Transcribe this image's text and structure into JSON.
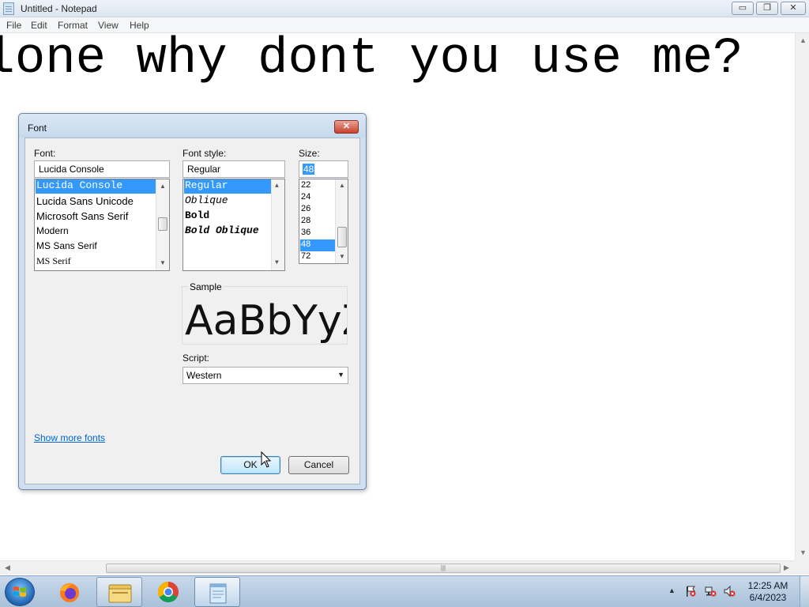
{
  "window": {
    "title": "Untitled - Notepad",
    "min_label": "▭",
    "max_label": "❐",
    "close_label": "✕"
  },
  "menu": [
    "File",
    "Edit",
    "Format",
    "View",
    "Help"
  ],
  "editor": {
    "text": "alone why dont you use me?"
  },
  "dialog": {
    "title": "Font",
    "close_label": "✕",
    "font_label": "Font:",
    "font_value": "Lucida Console",
    "fonts": [
      "Lucida Console",
      "Lucida Sans Unicode",
      "Microsoft Sans Serif",
      "Modern",
      "MS Sans Serif",
      "MS Serif"
    ],
    "style_label": "Font style:",
    "style_value": "Regular",
    "styles": [
      "Regular",
      "Oblique",
      "Bold",
      "Bold Oblique"
    ],
    "size_label": "Size:",
    "size_value": "48",
    "sizes": [
      "22",
      "24",
      "26",
      "28",
      "36",
      "48",
      "72"
    ],
    "sample_label": "Sample",
    "sample_text": "AaBbYyZz",
    "script_label": "Script:",
    "script_value": "Western",
    "more_fonts_link": "Show more fonts",
    "ok_label": "OK",
    "cancel_label": "Cancel"
  },
  "taskbar": {
    "time": "12:25 AM",
    "date": "6/4/2023"
  },
  "colors": {
    "selection": "#3399ff",
    "link": "#0066cc",
    "taskbar": "#b9cde2"
  }
}
